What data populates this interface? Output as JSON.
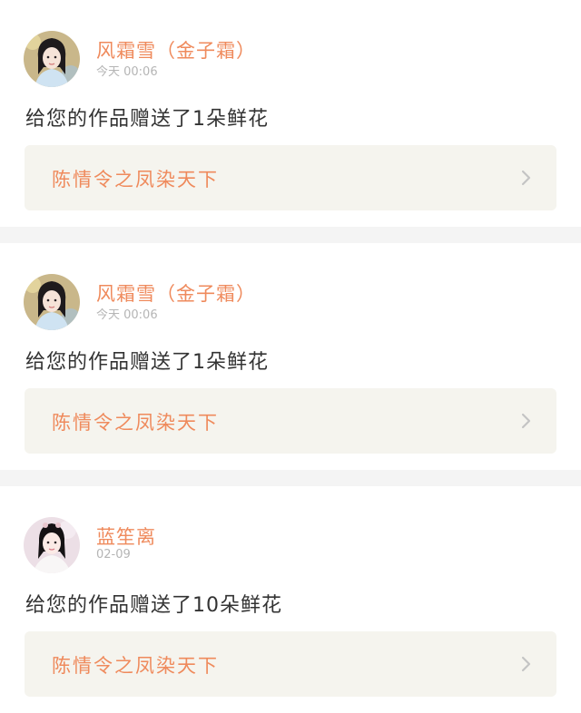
{
  "notifications": [
    {
      "user_name": "风霜雪（金子霜）",
      "time": "今天 00:06",
      "message": "给您的作品赠送了1朵鲜花",
      "work_title": "陈情令之凤染天下",
      "avatar_icon": "avatar-girl-blue-robe"
    },
    {
      "user_name": "风霜雪（金子霜）",
      "time": "今天 00:06",
      "message": "给您的作品赠送了1朵鲜花",
      "work_title": "陈情令之凤染天下",
      "avatar_icon": "avatar-girl-blue-robe"
    },
    {
      "user_name": "蓝笙离",
      "time": "02-09",
      "message": "给您的作品赠送了10朵鲜花",
      "work_title": "陈情令之凤染天下",
      "avatar_icon": "avatar-girl-white-robe"
    }
  ],
  "colors": {
    "accent": "#ef8a5c",
    "text": "#333333",
    "muted": "#b5b5b5",
    "link_bg": "#f5f4ee",
    "page_bg": "#f4f4f4"
  }
}
